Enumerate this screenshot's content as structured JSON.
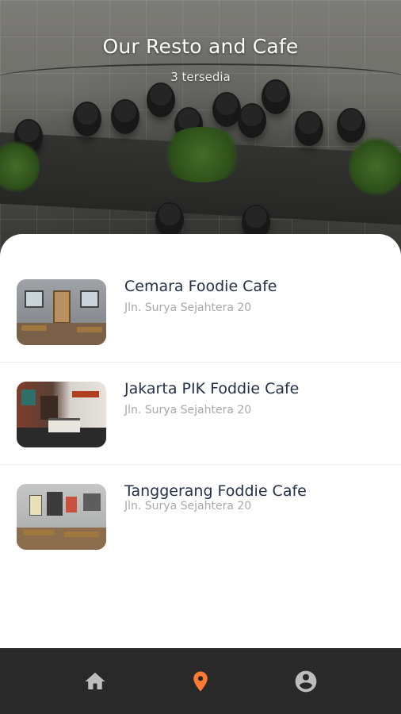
{
  "header": {
    "title": "Our Resto and Cafe",
    "subtitle": "3 tersedia"
  },
  "cafes": [
    {
      "name": "Cemara Foodie Cafe",
      "address": "Jln. Surya Sejahtera 20"
    },
    {
      "name": "Jakarta PIK Foddie Cafe",
      "address": "Jln. Surya Sejahtera 20"
    },
    {
      "name": "Tanggerang Foddie Cafe",
      "address": "Jln. Surya Sejahtera 20"
    }
  ],
  "bottom_nav": {
    "items": [
      {
        "icon": "home-icon",
        "active": false
      },
      {
        "icon": "location-pin-icon",
        "active": true
      },
      {
        "icon": "account-icon",
        "active": false
      }
    ],
    "active_color": "#ff7a33",
    "inactive_color": "#bdbdbd",
    "background": "#292929"
  }
}
